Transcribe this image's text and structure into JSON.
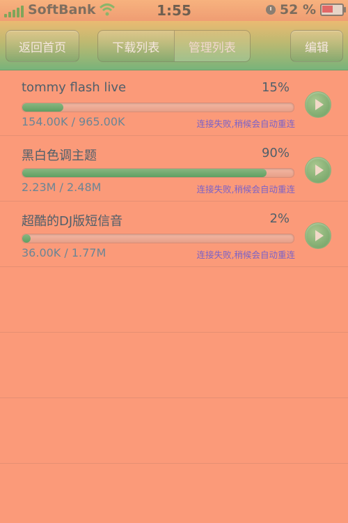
{
  "status_bar": {
    "carrier": "SoftBank",
    "time": "1:55",
    "battery_percent": "52",
    "battery_unit": "%",
    "battery_level": 0.52
  },
  "nav": {
    "home": "返回首页",
    "tabs": [
      {
        "label": "下载列表"
      },
      {
        "label": "管理列表"
      }
    ],
    "edit": "编辑"
  },
  "downloads": [
    {
      "name": "tommy flash live",
      "percent": "15%",
      "progress": 0.15,
      "size": "154.00K / 965.00K",
      "status": "连接失败,稍候会自动重连"
    },
    {
      "name": "黑白色调主题",
      "percent": "90%",
      "progress": 0.9,
      "size": "2.23M / 2.48M",
      "status": "连接失败,稍候会自动重连"
    },
    {
      "name": "超酷的DJ版短信音",
      "percent": "2%",
      "progress": 0.02,
      "size": "36.00K / 1.77M",
      "status": "连接失败,稍候会自动重连"
    }
  ],
  "colors": {
    "background": "#fb9a79",
    "progress_fill": "#6fa86a",
    "status_text": "#7b62c7"
  }
}
